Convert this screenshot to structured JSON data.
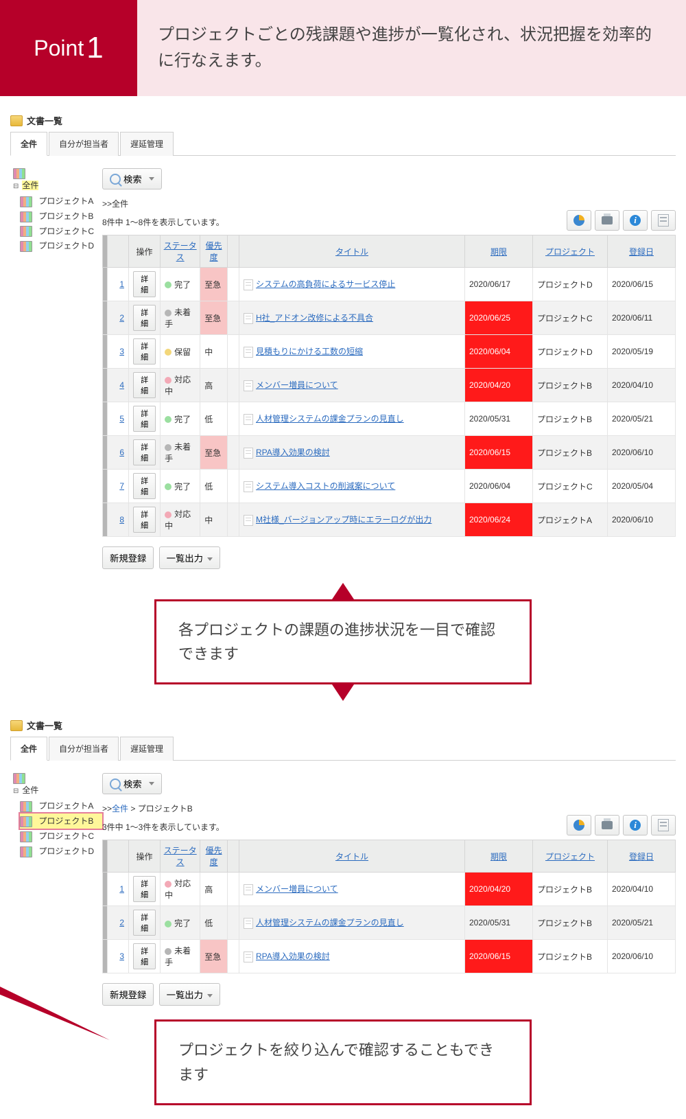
{
  "point": {
    "label": "Point",
    "num": "1",
    "desc": "プロジェクトごとの残課題や進捗が一覧化され、状況把握を効率的に行なえます。"
  },
  "panel_title": "文書一覧",
  "tabs": [
    "全件",
    "自分が担当者",
    "遅延管理"
  ],
  "tree": {
    "root": "全件",
    "items": [
      "プロジェクトA",
      "プロジェクトB",
      "プロジェクトC",
      "プロジェクトD"
    ]
  },
  "search_label": "検索",
  "breadcrumb_prefix": ">>",
  "breadcrumb_all": "全件",
  "columns": {
    "op": "操作",
    "status": "ステータス",
    "priority": "優先度",
    "title": "タイトル",
    "due": "期限",
    "project": "プロジェクト",
    "reg": "登録日"
  },
  "detail_label": "詳細",
  "status_colors": {
    "完了": "#9bdfa0",
    "未着手": "#b6b6b6",
    "保留": "#f3d77a",
    "対応中": "#f3a9b6"
  },
  "view1": {
    "breadcrumb": "全件",
    "count": "8件中 1〜8件を表示しています。",
    "rows": [
      {
        "n": "1",
        "status": "完了",
        "priority": "至急",
        "pri_urgent": true,
        "title": "システムの高負荷によるサービス停止",
        "due": "2020/06/17",
        "due_red": false,
        "project": "プロジェクトD",
        "reg": "2020/06/15"
      },
      {
        "n": "2",
        "status": "未着手",
        "priority": "至急",
        "pri_urgent": true,
        "title": "H社_アドオン改修による不具合",
        "due": "2020/06/25",
        "due_red": true,
        "project": "プロジェクトC",
        "reg": "2020/06/11"
      },
      {
        "n": "3",
        "status": "保留",
        "priority": "中",
        "pri_urgent": false,
        "title": "見積もりにかける工数の短縮",
        "due": "2020/06/04",
        "due_red": true,
        "project": "プロジェクトD",
        "reg": "2020/05/19"
      },
      {
        "n": "4",
        "status": "対応中",
        "priority": "高",
        "pri_urgent": false,
        "title": "メンバー増員について",
        "due": "2020/04/20",
        "due_red": true,
        "project": "プロジェクトB",
        "reg": "2020/04/10"
      },
      {
        "n": "5",
        "status": "完了",
        "priority": "低",
        "pri_urgent": false,
        "title": "人材管理システムの課金プランの見直し",
        "due": "2020/05/31",
        "due_red": false,
        "project": "プロジェクトB",
        "reg": "2020/05/21"
      },
      {
        "n": "6",
        "status": "未着手",
        "priority": "至急",
        "pri_urgent": true,
        "title": "RPA導入効果の検討",
        "due": "2020/06/15",
        "due_red": true,
        "project": "プロジェクトB",
        "reg": "2020/06/10"
      },
      {
        "n": "7",
        "status": "完了",
        "priority": "低",
        "pri_urgent": false,
        "title": "システム導入コストの削減案について",
        "due": "2020/06/04",
        "due_red": false,
        "project": "プロジェクトC",
        "reg": "2020/05/04"
      },
      {
        "n": "8",
        "status": "対応中",
        "priority": "中",
        "pri_urgent": false,
        "title": "M社様_バージョンアップ時にエラーログが出力",
        "due": "2020/06/24",
        "due_red": true,
        "project": "プロジェクトA",
        "reg": "2020/06/10"
      }
    ]
  },
  "view2": {
    "breadcrumb": "プロジェクトB",
    "count": "3件中 1〜3件を表示しています。",
    "rows": [
      {
        "n": "1",
        "status": "対応中",
        "priority": "高",
        "pri_urgent": false,
        "title": "メンバー増員について",
        "due": "2020/04/20",
        "due_red": true,
        "project": "プロジェクトB",
        "reg": "2020/04/10"
      },
      {
        "n": "2",
        "status": "完了",
        "priority": "低",
        "pri_urgent": false,
        "title": "人材管理システムの課金プランの見直し",
        "due": "2020/05/31",
        "due_red": false,
        "project": "プロジェクトB",
        "reg": "2020/05/21"
      },
      {
        "n": "3",
        "status": "未着手",
        "priority": "至急",
        "pri_urgent": true,
        "title": "RPA導入効果の検討",
        "due": "2020/06/15",
        "due_red": true,
        "project": "プロジェクトB",
        "reg": "2020/06/10"
      }
    ]
  },
  "actions": {
    "new": "新規登録",
    "export": "一覧出力"
  },
  "callout1": "各プロジェクトの課題の進捗状況を一目で確認できます",
  "callout2": "プロジェクトを絞り込んで確認することもできます"
}
